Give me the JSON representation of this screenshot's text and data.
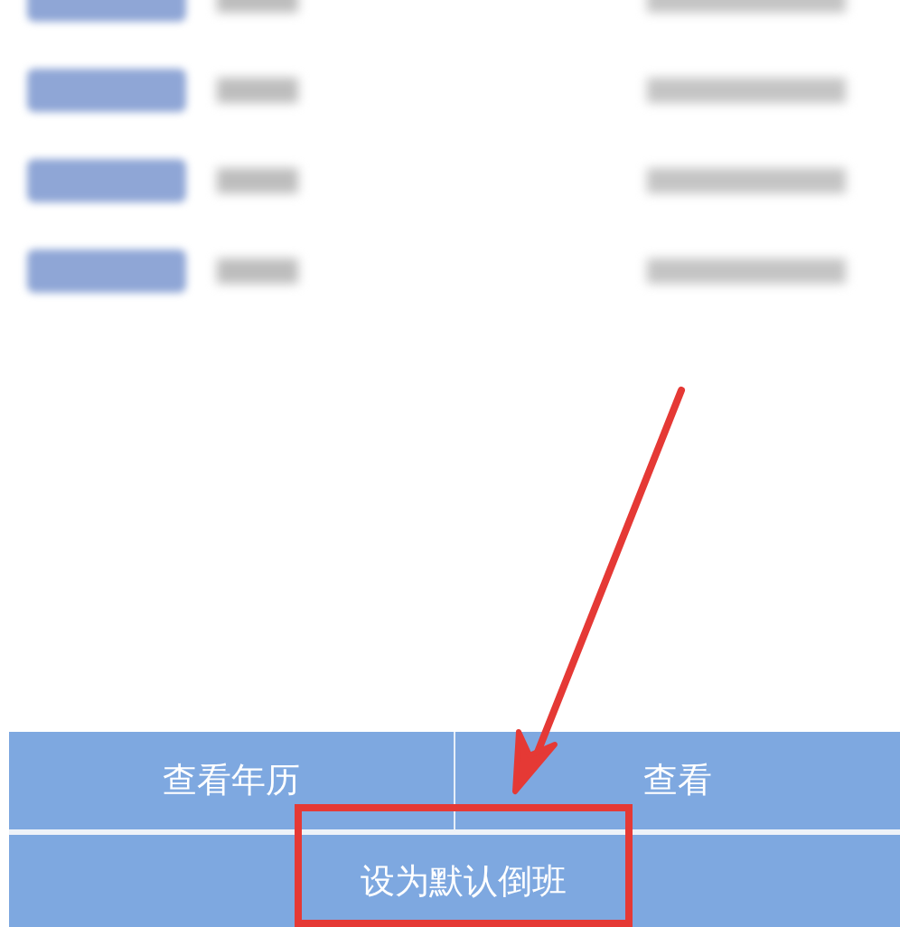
{
  "shift_rows": [
    {
      "redacted": true
    },
    {
      "redacted": true
    },
    {
      "redacted": true
    },
    {
      "redacted": true
    }
  ],
  "bottom_bar": {
    "buttons": [
      {
        "label": "查看年历"
      },
      {
        "label": "查看"
      }
    ],
    "primary_button": {
      "label": "设为默认倒班"
    }
  },
  "annotations": {
    "arrow": true,
    "highlight_box": true
  }
}
